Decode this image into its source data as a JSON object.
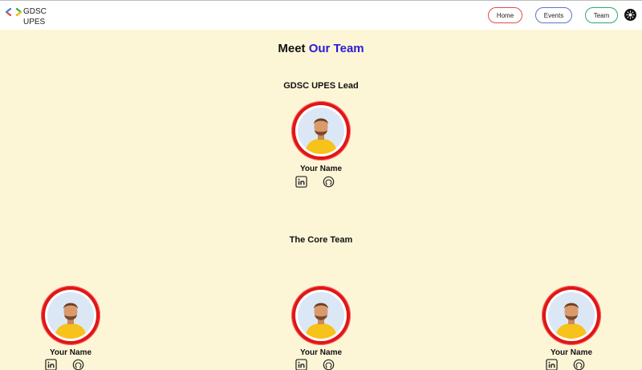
{
  "brand": {
    "line1": "GDSC",
    "line2": "UPES"
  },
  "nav": {
    "home": "Home",
    "events": "Events",
    "team": "Team"
  },
  "title": {
    "prefix": "Meet",
    "accent": "Our Team"
  },
  "lead_section": {
    "heading": "GDSC UPES Lead",
    "member": {
      "name": "Your Name"
    }
  },
  "core_section": {
    "heading": "The Core Team",
    "members": [
      {
        "name": "Your Name"
      },
      {
        "name": "Your Name"
      },
      {
        "name": "Your Name"
      }
    ]
  },
  "icons": {
    "logo": "gdsc-logo",
    "theme": "sun-icon",
    "linkedin": "linkedin-icon",
    "github": "github-icon"
  },
  "colors": {
    "background": "#fdf6d6",
    "accent": "#2a1bd6",
    "avatar_ring": "#e01616",
    "home_border": "#e34b4b",
    "events_border": "#5a73c9",
    "team_border": "#2eaa6c"
  }
}
